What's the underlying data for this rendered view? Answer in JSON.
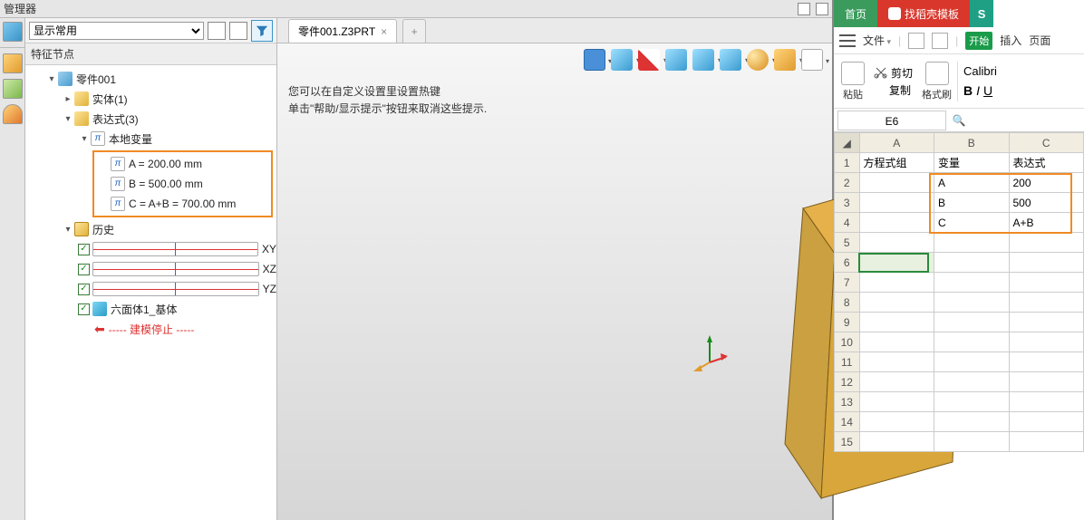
{
  "cad": {
    "manager_title": "管理器",
    "filter_label": "显示常用",
    "tree_header": "特征节点",
    "root": "零件001",
    "solid": "实体(1)",
    "expr": "表达式(3)",
    "localvar": "本地变量",
    "vars": {
      "a": "A = 200.00 mm",
      "b": "B = 500.00 mm",
      "c": "C = A+B = 700.00 mm"
    },
    "history": "历史",
    "planes": {
      "xy": "XY",
      "xz": "XZ",
      "yz": "YZ"
    },
    "feature1": "六面体1_基体",
    "stop": "----- 建模停止 -----",
    "tab": "零件001.Z3PRT",
    "hint1": "您可以在自定义设置里设置热键",
    "hint2": "单击\"帮助/显示提示\"按钮来取消这些提示."
  },
  "sheet": {
    "tabs": {
      "home": "首页",
      "tpl": "找稻壳模板"
    },
    "menu": {
      "file": "文件",
      "start": "开始",
      "insert": "插入",
      "page": "页面"
    },
    "tools": {
      "paste": "粘贴",
      "cut": "剪切",
      "copy": "复制",
      "fmt": "格式刷"
    },
    "font": "Calibri",
    "cellref": "E6",
    "headers": {
      "a": "A",
      "b": "B",
      "c": "C"
    },
    "row1": {
      "a": "方程式组",
      "b": "变量",
      "c": "表达式"
    },
    "rows": [
      {
        "n": "2",
        "b": "A",
        "c": "200"
      },
      {
        "n": "3",
        "b": "B",
        "c": "500"
      },
      {
        "n": "4",
        "b": "C",
        "c": "A+B"
      }
    ],
    "empty": [
      "5",
      "6",
      "7",
      "8",
      "9",
      "10",
      "11",
      "12",
      "13",
      "14",
      "15"
    ]
  }
}
